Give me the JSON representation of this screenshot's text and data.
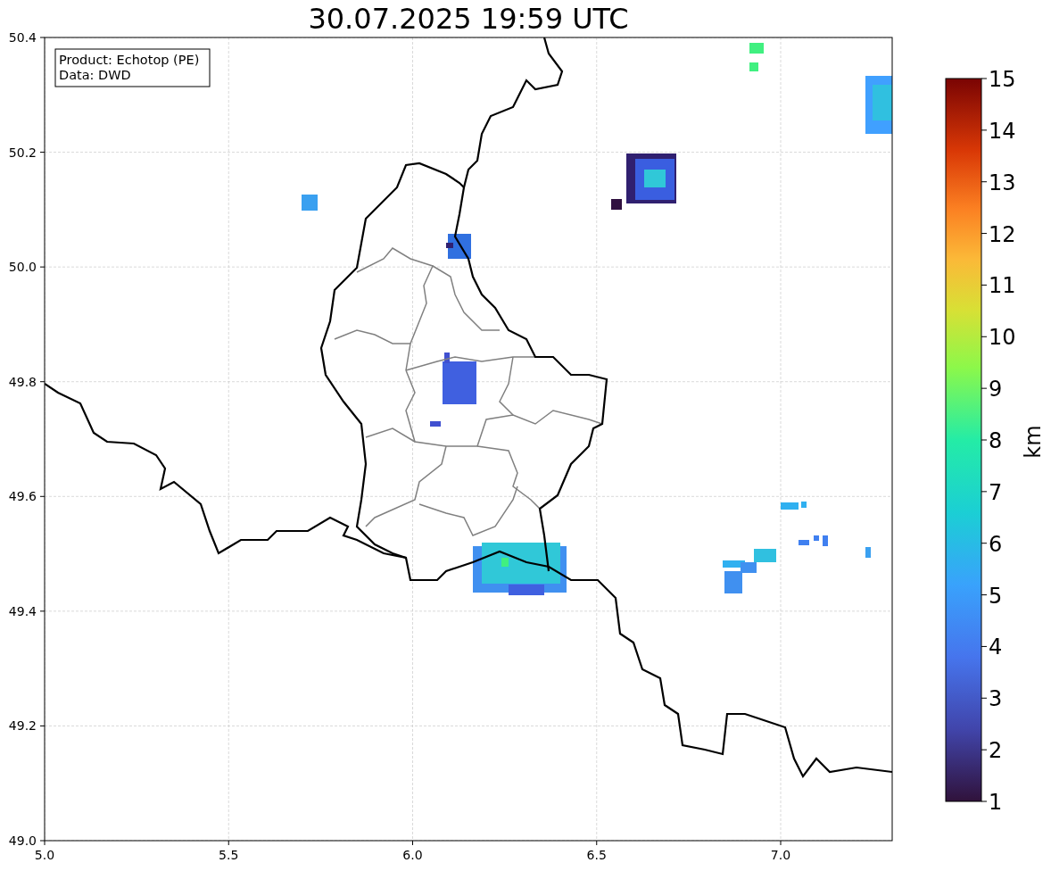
{
  "title": "30.07.2025 19:59 UTC",
  "info_box": [
    "Product: Echotop (PE)",
    "Data: DWD"
  ],
  "map": {
    "x_ticks": [
      "5.0",
      "5.5",
      "6.0",
      "6.5",
      "7.0"
    ],
    "y_ticks": [
      "50.4",
      "50.2",
      "50.0",
      "49.8",
      "49.6",
      "49.4",
      "49.2",
      "49.0"
    ]
  },
  "colorbar": {
    "label": "km",
    "ticks": [
      "15",
      "14",
      "13",
      "12",
      "11",
      "10",
      "9",
      "8",
      "7",
      "6",
      "5",
      "4",
      "3",
      "2",
      "1"
    ]
  }
}
